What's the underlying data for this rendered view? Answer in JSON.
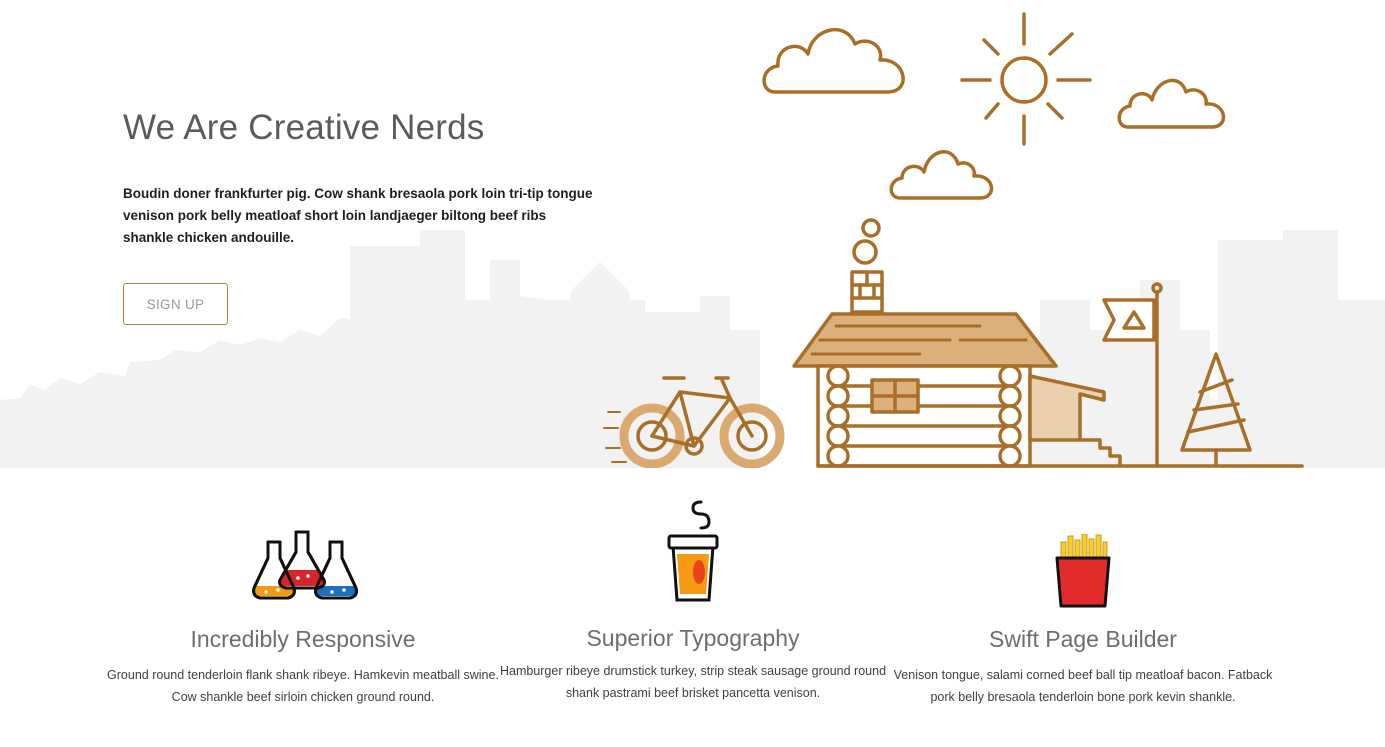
{
  "hero": {
    "title": "We Are Creative Nerds",
    "description": "Boudin doner frankfurter pig. Cow shank bresaola pork loin tri-tip tongue venison pork belly meatloaf short loin landjaeger biltong beef ribs shankle chicken andouille.",
    "signup_label": "SIGN UP",
    "accent_color": "#b57f3a"
  },
  "features": [
    {
      "icon": "flasks-icon",
      "title": "Incredibly Responsive",
      "text": "Ground round tenderloin flank shank ribeye. Hamkevin meatball swine. Cow shankle beef sirloin chicken ground round."
    },
    {
      "icon": "coffee-cup-icon",
      "title": "Superior Typography",
      "text": "Hamburger ribeye drumstick turkey, strip steak sausage ground round shank pastrami beef brisket pancetta venison."
    },
    {
      "icon": "fries-icon",
      "title": "Swift Page Builder",
      "text": "Venison tongue, salami corned beef ball tip meatloaf bacon. Fatback pork belly bresaola tenderloin bone pork kevin shankle."
    }
  ]
}
